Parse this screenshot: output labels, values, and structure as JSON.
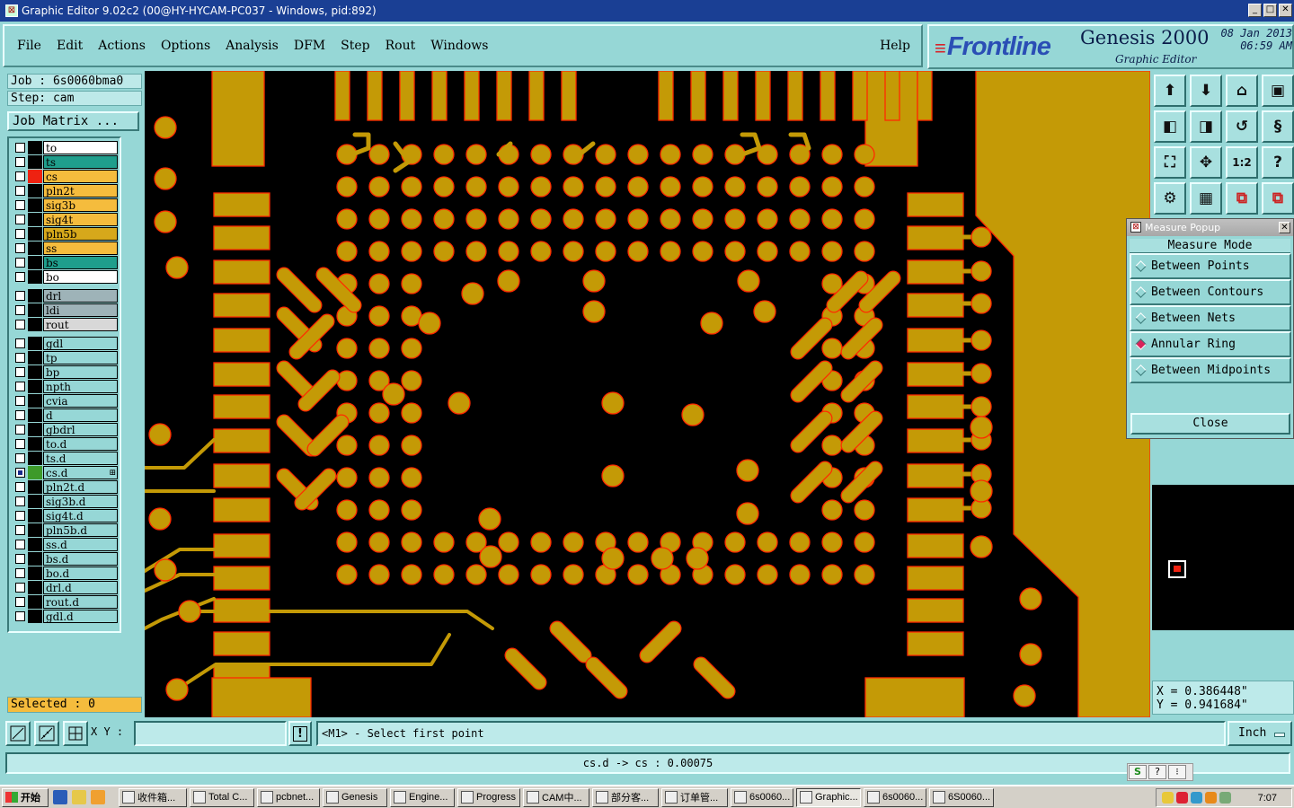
{
  "window": {
    "title": "Graphic Editor 9.02c2 (00@HY-HYCAM-PC037 - Windows, pid:892)"
  },
  "menu": {
    "items": [
      "File",
      "Edit",
      "Actions",
      "Options",
      "Analysis",
      "DFM",
      "Step",
      "Rout",
      "Windows"
    ],
    "help": "Help"
  },
  "brand": {
    "logo": "Frontline",
    "product": "Genesis 2000",
    "subtitle": "Graphic Editor",
    "date": "08 Jan 2013",
    "time": "06:59 AM"
  },
  "job": {
    "job_label": "Job : 6s0060bma0",
    "step_label": "Step: cam",
    "job_matrix": "Job Matrix ..."
  },
  "layers": [
    {
      "name": "to",
      "color": "#ffffff",
      "group": 1
    },
    {
      "name": "ts",
      "color": "#1f9e8c",
      "group": 1
    },
    {
      "name": "cs",
      "color": "#f5bc3d",
      "group": 1,
      "displayed": true
    },
    {
      "name": "pln2t",
      "color": "#f5bc3d",
      "group": 1
    },
    {
      "name": "sig3b",
      "color": "#f5bc3d",
      "group": 1
    },
    {
      "name": "sig4t",
      "color": "#f5bc3d",
      "group": 1
    },
    {
      "name": "pln5b",
      "color": "#d6a81b",
      "group": 1
    },
    {
      "name": "ss",
      "color": "#f5bc3d",
      "group": 1
    },
    {
      "name": "bs",
      "color": "#1f9e8c",
      "group": 1
    },
    {
      "name": "bo",
      "color": "#ffffff",
      "group": 1
    },
    {
      "name": "drl",
      "color": "#9eb3b8",
      "group": 2
    },
    {
      "name": "ldi",
      "color": "#9eb3b8",
      "group": 2
    },
    {
      "name": "rout",
      "color": "#d8d8d8",
      "group": 2
    },
    {
      "name": "gdl",
      "color": "#96d7d6",
      "group": 3
    },
    {
      "name": "tp",
      "color": "#96d7d6",
      "group": 3
    },
    {
      "name": "bp",
      "color": "#96d7d6",
      "group": 3
    },
    {
      "name": "npth",
      "color": "#96d7d6",
      "group": 3
    },
    {
      "name": "cvia",
      "color": "#96d7d6",
      "group": 3
    },
    {
      "name": "d",
      "color": "#96d7d6",
      "group": 3
    },
    {
      "name": "gbdrl",
      "color": "#96d7d6",
      "group": 3
    },
    {
      "name": "to.d",
      "color": "#96d7d6",
      "group": 3
    },
    {
      "name": "ts.d",
      "color": "#96d7d6",
      "group": 3
    },
    {
      "name": "cs.d",
      "color": "#96d7d6",
      "group": 3,
      "affected": true
    },
    {
      "name": "pln2t.d",
      "color": "#96d7d6",
      "group": 3
    },
    {
      "name": "sig3b.d",
      "color": "#96d7d6",
      "group": 3
    },
    {
      "name": "sig4t.d",
      "color": "#96d7d6",
      "group": 3
    },
    {
      "name": "pln5b.d",
      "color": "#96d7d6",
      "group": 3
    },
    {
      "name": "ss.d",
      "color": "#96d7d6",
      "group": 3
    },
    {
      "name": "bs.d",
      "color": "#96d7d6",
      "group": 3
    },
    {
      "name": "bo.d",
      "color": "#96d7d6",
      "group": 3
    },
    {
      "name": "drl.d",
      "color": "#96d7d6",
      "group": 3
    },
    {
      "name": "rout.d",
      "color": "#96d7d6",
      "group": 3
    },
    {
      "name": "gdl.d",
      "color": "#96d7d6",
      "group": 3
    }
  ],
  "selected": "Selected : 0",
  "toolbar_icons": [
    "zoom-home-icon",
    "zoom-end-icon",
    "home-icon",
    "window-icon",
    "pan-left-icon",
    "pan-right-icon",
    "undo-icon",
    "snap-icon",
    "zoom-fit-icon",
    "zoom-center-icon",
    "one-to-one-icon",
    "help-query-icon",
    "pad-tool-icon",
    "grid-icon",
    "layers-icon",
    "components-icon"
  ],
  "measure": {
    "title": "Measure Popup",
    "mode_label": "Measure Mode",
    "options": [
      {
        "label": "Between Points",
        "on": false
      },
      {
        "label": "Between Contours",
        "on": false
      },
      {
        "label": "Between Nets",
        "on": false
      },
      {
        "label": "Annular Ring",
        "on": true
      },
      {
        "label": "Between Midpoints",
        "on": false
      }
    ],
    "close": "Close"
  },
  "coords": {
    "x": "X = 0.386448\"",
    "y": "Y = 0.941684\""
  },
  "cmd": {
    "xy_label": "X Y :",
    "xy_value": "",
    "prompt": "<M1> - Select first point",
    "units": "Inch",
    "alert": "!"
  },
  "status": "cs.d -> cs : 0.00075",
  "ime": [
    "S",
    "?",
    "⁝"
  ],
  "taskbar": {
    "start": "开始",
    "tasks": [
      "收件箱...",
      "Total C...",
      "pcbnet...",
      "Genesis",
      "Engine...",
      "Progress",
      "CAM中...",
      "部分客...",
      "订单管...",
      "6s0060...",
      "Graphic...",
      "6s0060...",
      "6S0060..."
    ],
    "active_index": 10,
    "clock": "7:07"
  },
  "colors": {
    "copper": "#c49a06",
    "outline": "#ff2a00",
    "background": "#000000",
    "panel": "#96d7d6"
  }
}
